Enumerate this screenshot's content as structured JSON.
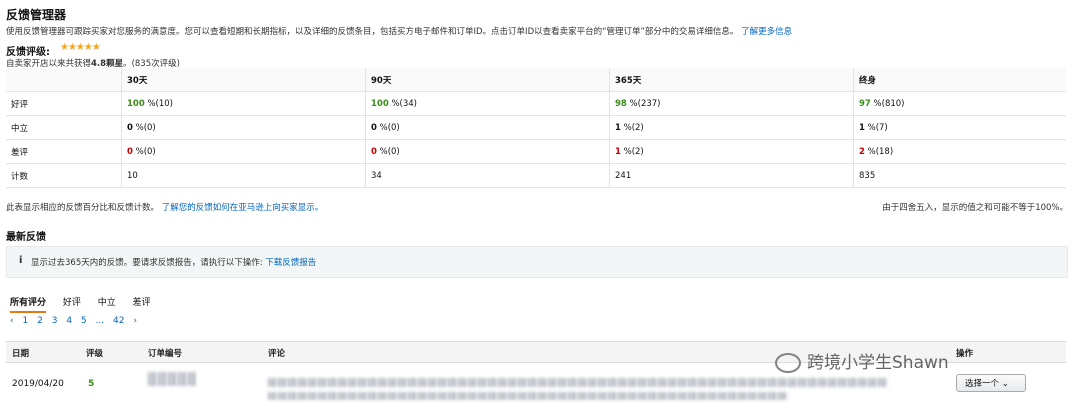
{
  "header": {
    "title": "反馈管理器",
    "description": "使用反馈管理器可跟踪买家对您服务的满意度。您可以查看短期和长期指标，以及详细的反馈条目，包括买方电子邮件和订单ID。点击订单ID以查看卖家平台的“管理订单”部分中的交易详细信息。",
    "learn_more": "了解更多信息"
  },
  "rating": {
    "label": "反馈评级:",
    "stars": "★★★★★",
    "summary_prefix": "自卖家开店以来共获得",
    "summary_score": "4.8颗星",
    "summary_suffix": "。(835次评级)"
  },
  "table": {
    "headers": [
      "",
      "30天",
      "90天",
      "365天",
      "终身"
    ],
    "rows": [
      {
        "label": "好评",
        "cells": [
          [
            "100",
            " %(10)"
          ],
          [
            "100",
            " %(34)"
          ],
          [
            "98",
            " %(237)"
          ],
          [
            "97",
            " %(810)"
          ]
        ]
      },
      {
        "label": "中立",
        "cells": [
          [
            "0",
            " %(0)"
          ],
          [
            "0",
            " %(0)"
          ],
          [
            "1",
            " %(2)"
          ],
          [
            "1",
            " %(7)"
          ]
        ]
      },
      {
        "label": "差评",
        "cells": [
          [
            "0",
            " %(0)"
          ],
          [
            "0",
            " %(0)"
          ],
          [
            "1",
            " %(2)"
          ],
          [
            "2",
            " %(18)"
          ]
        ]
      },
      {
        "label": "计数",
        "cells": [
          [
            "10",
            ""
          ],
          [
            "34",
            ""
          ],
          [
            "241",
            ""
          ],
          [
            "835",
            ""
          ]
        ]
      }
    ]
  },
  "notes": {
    "left_text": "此表显示相应的反馈百分比和反馈计数。",
    "left_link": "了解您的反馈如何在亚马逊上向买家显示。",
    "right": "由于四舍五入，显示的值之和可能不等于100%。"
  },
  "recent": {
    "title": "最新反馈",
    "info_icon": "i",
    "info_text": "显示过去365天内的反馈。要请求反馈报告，请执行以下操作:",
    "info_link": "下载反馈报告"
  },
  "tabs": [
    "所有评分",
    "好评",
    "中立",
    "差评"
  ],
  "pager": [
    "‹",
    "1",
    "2",
    "3",
    "4",
    "5",
    "...",
    "42",
    "›"
  ],
  "list": {
    "columns": [
      "日期",
      "评级",
      "订单编号",
      "评论",
      "操作"
    ],
    "row": {
      "date": "2019/04/20",
      "rating": "5",
      "action": "选择一个 ⌄"
    }
  },
  "watermark": "跨境小学生Shawn",
  "colors": {
    "positive": "#3a8c1d",
    "negative": "#c40000",
    "link": "#0066c0",
    "star": "#f5a623"
  }
}
